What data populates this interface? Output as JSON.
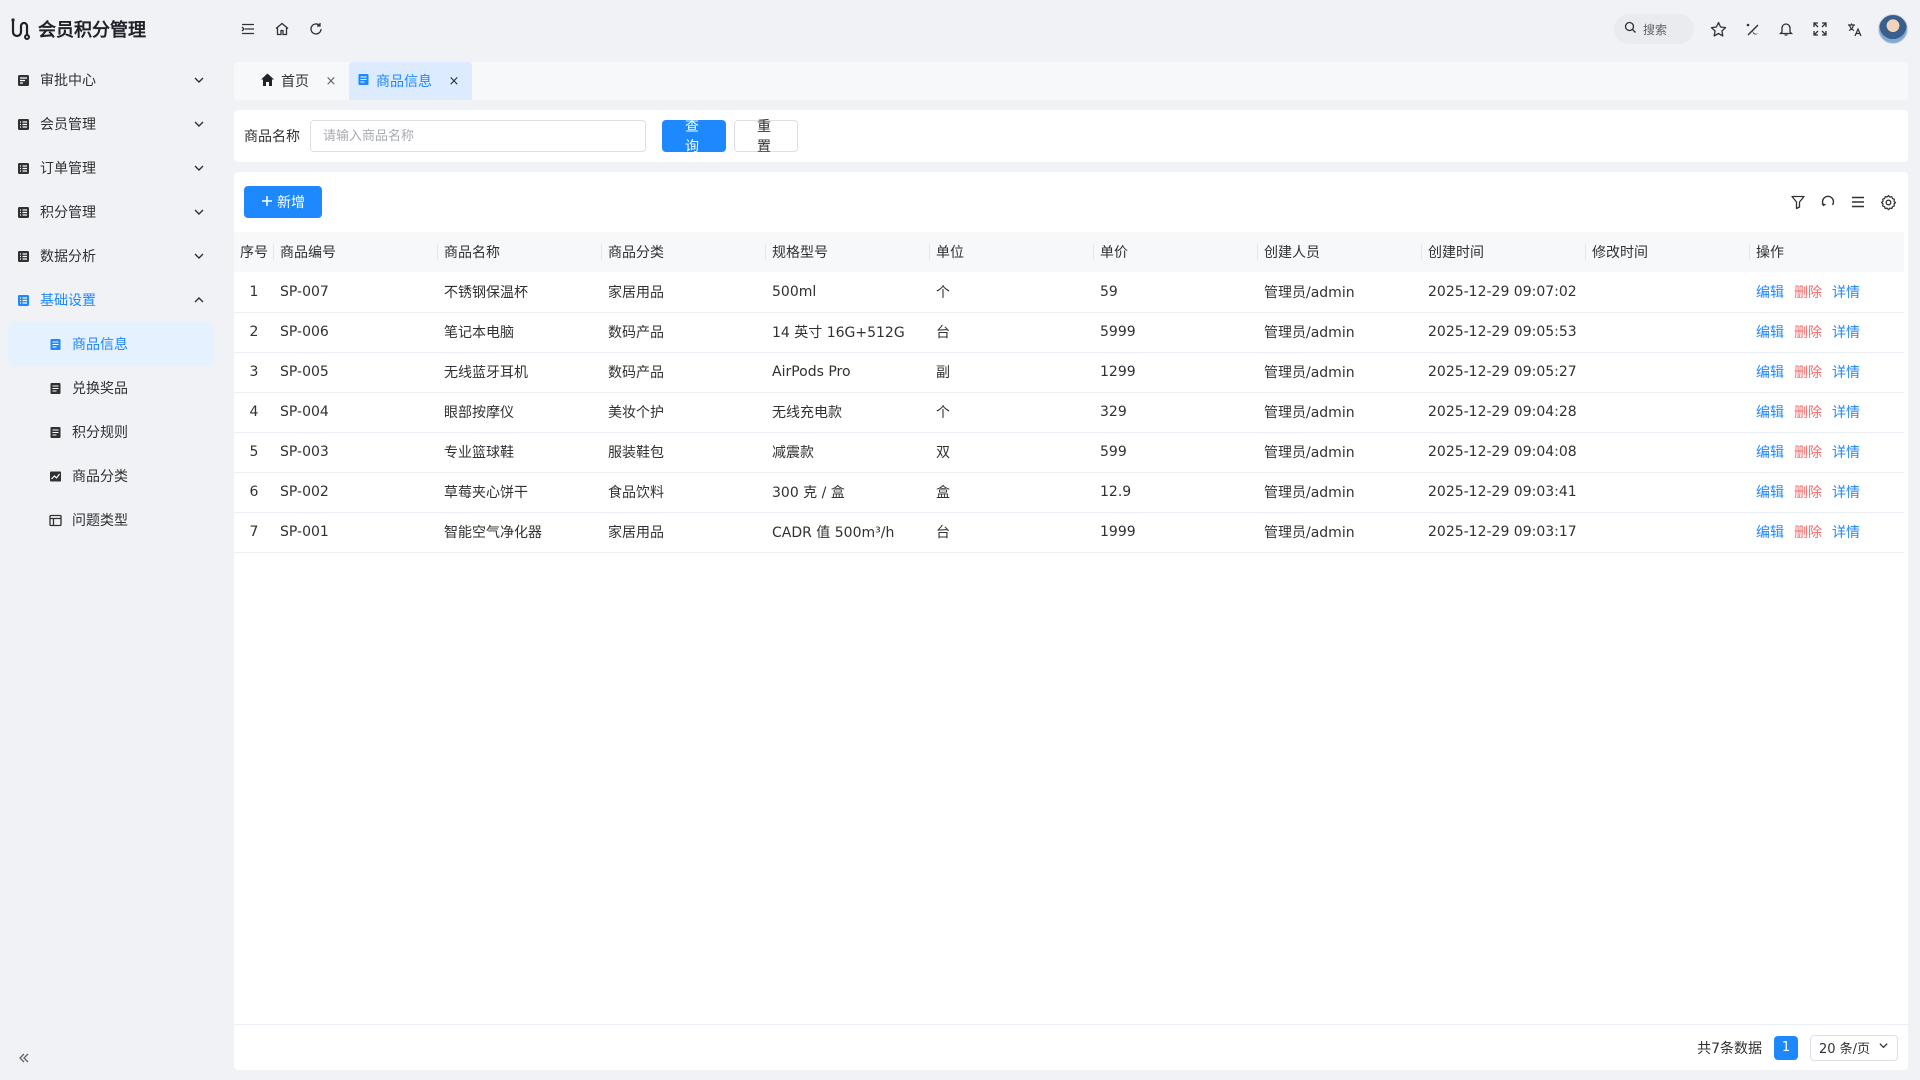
{
  "app": {
    "title": "会员积分管理"
  },
  "sidebar": {
    "menus": [
      {
        "label": "审批中心",
        "icon": "approval-icon",
        "expanded": false
      },
      {
        "label": "会员管理",
        "icon": "member-icon",
        "expanded": false
      },
      {
        "label": "订单管理",
        "icon": "order-icon",
        "expanded": false
      },
      {
        "label": "积分管理",
        "icon": "points-icon",
        "expanded": false
      },
      {
        "label": "数据分析",
        "icon": "analytics-icon",
        "expanded": false
      },
      {
        "label": "基础设置",
        "icon": "settings-list-icon",
        "expanded": true
      }
    ],
    "submenu": [
      {
        "label": "商品信息",
        "icon": "document-icon",
        "active": true
      },
      {
        "label": "兑换奖品",
        "icon": "document-icon",
        "active": false
      },
      {
        "label": "积分规则",
        "icon": "document-icon",
        "active": false
      },
      {
        "label": "商品分类",
        "icon": "chart-icon",
        "active": false
      },
      {
        "label": "问题类型",
        "icon": "table-icon",
        "active": false
      }
    ]
  },
  "header": {
    "search_label": "搜索"
  },
  "tabs": [
    {
      "label": "首页",
      "active": false
    },
    {
      "label": "商品信息",
      "active": true
    }
  ],
  "query": {
    "field_label": "商品名称",
    "placeholder": "请输入商品名称",
    "value": "",
    "search_label": "查询",
    "reset_label": "重置"
  },
  "toolbar": {
    "add_label": "新增"
  },
  "table": {
    "columns": [
      "序号",
      "商品编号",
      "商品名称",
      "商品分类",
      "规格型号",
      "单位",
      "单价",
      "创建人员",
      "创建时间",
      "修改时间",
      "操作"
    ],
    "rows": [
      {
        "idx": "1",
        "code": "SP-007",
        "name": "不锈钢保温杯",
        "category": "家居用品",
        "spec": "500ml",
        "unit": "个",
        "price": "59",
        "creator": "管理员/admin",
        "created": "2025-12-29 09:07:02",
        "modified": ""
      },
      {
        "idx": "2",
        "code": "SP-006",
        "name": "笔记本电脑",
        "category": "数码产品",
        "spec": "14 英寸 16G+512G",
        "unit": "台",
        "price": "5999",
        "creator": "管理员/admin",
        "created": "2025-12-29 09:05:53",
        "modified": ""
      },
      {
        "idx": "3",
        "code": "SP-005",
        "name": "无线蓝牙耳机",
        "category": "数码产品",
        "spec": "AirPods Pro",
        "unit": "副",
        "price": "1299",
        "creator": "管理员/admin",
        "created": "2025-12-29 09:05:27",
        "modified": ""
      },
      {
        "idx": "4",
        "code": "SP-004",
        "name": "眼部按摩仪",
        "category": "美妆个护",
        "spec": "无线充电款",
        "unit": "个",
        "price": "329",
        "creator": "管理员/admin",
        "created": "2025-12-29 09:04:28",
        "modified": ""
      },
      {
        "idx": "5",
        "code": "SP-003",
        "name": "专业篮球鞋",
        "category": "服装鞋包",
        "spec": "减震款",
        "unit": "双",
        "price": "599",
        "creator": "管理员/admin",
        "created": "2025-12-29 09:04:08",
        "modified": ""
      },
      {
        "idx": "6",
        "code": "SP-002",
        "name": "草莓夹心饼干",
        "category": "食品饮料",
        "spec": "300 克 / 盒",
        "unit": "盒",
        "price": "12.9",
        "creator": "管理员/admin",
        "created": "2025-12-29 09:03:41",
        "modified": ""
      },
      {
        "idx": "7",
        "code": "SP-001",
        "name": "智能空气净化器",
        "category": "家居用品",
        "spec": "CADR 值 500m³/h",
        "unit": "台",
        "price": "1999",
        "creator": "管理员/admin",
        "created": "2025-12-29 09:03:17",
        "modified": ""
      }
    ],
    "actions": {
      "edit": "编辑",
      "delete": "删除",
      "detail": "详情"
    }
  },
  "pagination": {
    "total_text": "共7条数据",
    "current_page": "1",
    "page_size": "20 条/页"
  },
  "colors": {
    "primary": "#1e88ff",
    "danger": "#f56c6c",
    "sidebar_bg": "#f0f2f5"
  }
}
